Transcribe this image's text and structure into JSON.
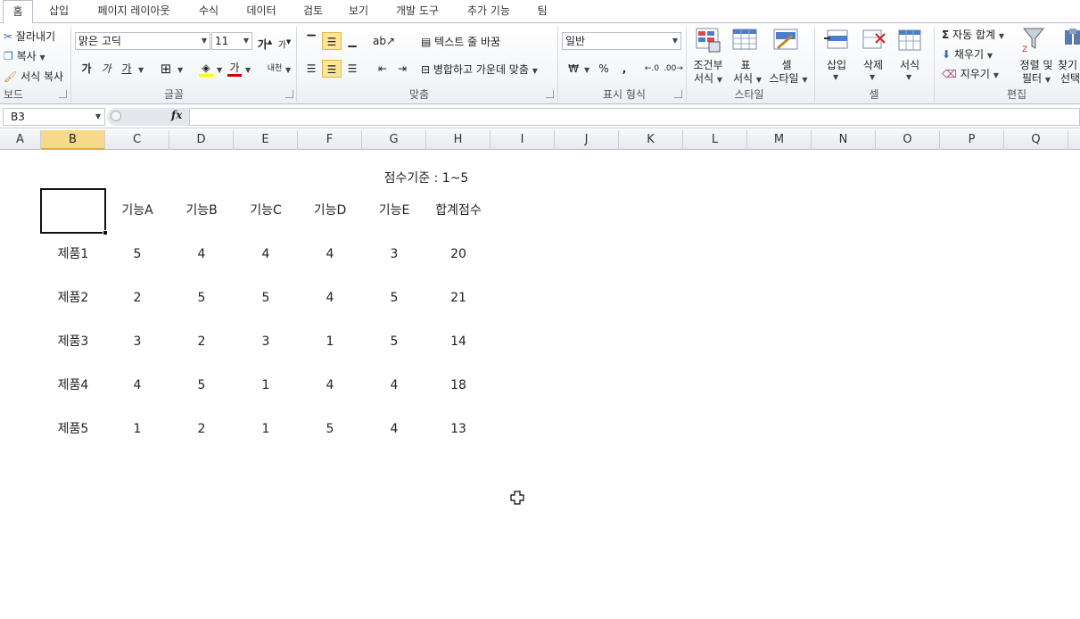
{
  "ribbon_tabs": [
    "홈",
    "삽입",
    "페이지 레이아웃",
    "수식",
    "데이터",
    "검토",
    "보기",
    "개발 도구",
    "추가 기능",
    "팀"
  ],
  "clipboard": {
    "cut": "잘라내기",
    "copy": "복사",
    "format_painter": "서식 복사",
    "label": "보드"
  },
  "font": {
    "name": "맑은 고딕",
    "size": "11",
    "bold": "가",
    "italic": "가",
    "underline": "가",
    "color_a": "가",
    "phonetic": "내천",
    "label": "글꼴"
  },
  "alignment": {
    "wrap_text": "텍스트 줄 바꿈",
    "merge_center": "병합하고 가운데 맞춤",
    "label": "맞춤"
  },
  "number": {
    "format": "일반",
    "percent": "%",
    "comma": ",",
    "label": "표시 형식"
  },
  "styles": {
    "conditional": [
      "조건부",
      "서식"
    ],
    "table": [
      "표",
      "서식"
    ],
    "cell": [
      "셀",
      "스타일"
    ],
    "label": "스타일"
  },
  "cells": {
    "insert": "삽입",
    "delete": "삭제",
    "format": "서식",
    "label": "셀"
  },
  "editing": {
    "autosum": "자동 합계",
    "fill": "채우기",
    "clear": "지우기",
    "sort": [
      "정렬 및",
      "필터"
    ],
    "find": [
      "찾기",
      "선택"
    ],
    "label": "편집"
  },
  "formula_bar": {
    "name_box": "B3",
    "fx": "fx",
    "formula": ""
  },
  "columns": [
    "A",
    "B",
    "C",
    "D",
    "E",
    "F",
    "G",
    "H",
    "I",
    "J",
    "K",
    "L",
    "M",
    "N",
    "O",
    "P",
    "Q"
  ],
  "active_column": "B",
  "sheet": {
    "note": "점수기준 : 1~5",
    "headers": [
      "기능A",
      "기능B",
      "기능C",
      "기능D",
      "기능E",
      "합계점수"
    ],
    "rows": [
      {
        "name": "제품1",
        "values": [
          "5",
          "4",
          "4",
          "4",
          "3",
          "20"
        ]
      },
      {
        "name": "제품2",
        "values": [
          "2",
          "5",
          "5",
          "4",
          "5",
          "21"
        ]
      },
      {
        "name": "제품3",
        "values": [
          "3",
          "2",
          "3",
          "1",
          "5",
          "14"
        ]
      },
      {
        "name": "제품4",
        "values": [
          "4",
          "5",
          "1",
          "4",
          "4",
          "18"
        ]
      },
      {
        "name": "제품5",
        "values": [
          "1",
          "2",
          "1",
          "5",
          "4",
          "13"
        ]
      }
    ]
  },
  "colors": {
    "selected_col": "#f7d98b",
    "accent": "#e2a93d",
    "font_color_bar": "#d00000",
    "fill_color_bar": "#ffff00"
  }
}
